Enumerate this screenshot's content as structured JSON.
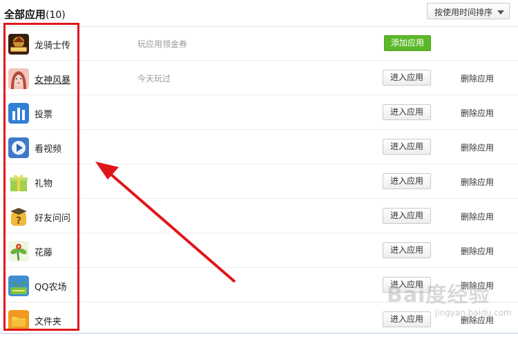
{
  "header": {
    "title": "全部应用",
    "count": "(10)",
    "sort_label": "按使用时间排序"
  },
  "apps": [
    {
      "name": "龙骑士传",
      "desc": "玩应用领金券",
      "action": "添加应用",
      "delete": ""
    },
    {
      "name": "女神风暴",
      "desc": "今天玩过",
      "action": "进入应用",
      "delete": "删除应用"
    },
    {
      "name": "投票",
      "desc": "",
      "action": "进入应用",
      "delete": "删除应用"
    },
    {
      "name": "看视频",
      "desc": "",
      "action": "进入应用",
      "delete": "删除应用"
    },
    {
      "name": "礼物",
      "desc": "",
      "action": "进入应用",
      "delete": "删除应用"
    },
    {
      "name": "好友问问",
      "desc": "",
      "action": "进入应用",
      "delete": "删除应用"
    },
    {
      "name": "花藤",
      "desc": "",
      "action": "进入应用",
      "delete": "删除应用"
    },
    {
      "name": "QQ农场",
      "desc": "",
      "action": "进入应用",
      "delete": "删除应用"
    },
    {
      "name": "文件夹",
      "desc": "",
      "action": "进入应用",
      "delete": "删除应用"
    }
  ],
  "icons": [
    "dragon-knight-icon",
    "goddess-icon",
    "vote-icon",
    "video-icon",
    "gift-icon",
    "question-icon",
    "flower-vine-icon",
    "farm-icon",
    "folder-icon"
  ],
  "colors": {
    "highlight": "#e0151b",
    "add_button": "#5cb82a"
  },
  "watermark": {
    "logo": "Bai度经验",
    "url": "jingyan.baidu.com"
  }
}
